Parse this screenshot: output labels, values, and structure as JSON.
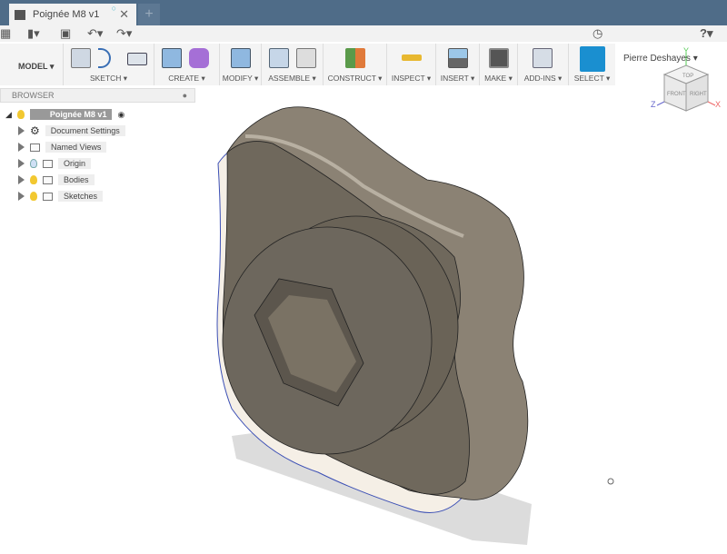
{
  "window": {
    "tab_title": "Poignée M8 v1",
    "new_tab": "+",
    "close": "✕"
  },
  "quickbar": {
    "user": "Pierre Deshayes ▾",
    "help": "?▾",
    "clock_icon": "clock-icon"
  },
  "ribbon": {
    "workspace": "MODEL ▾",
    "groups": [
      "SKETCH ▾",
      "CREATE ▾",
      "MODIFY ▾",
      "ASSEMBLE ▾",
      "CONSTRUCT ▾",
      "INSPECT ▾",
      "INSERT ▾",
      "MAKE ▾",
      "ADD-INS ▾",
      "SELECT ▾"
    ]
  },
  "browser": {
    "title": "BROWSER",
    "root": "Poignée M8 v1",
    "items": [
      "Document Settings",
      "Named Views",
      "Origin",
      "Bodies",
      "Sketches"
    ]
  },
  "viewcube": {
    "top": "TOP",
    "front": "FRONT",
    "right": "RIGHT",
    "x": "X",
    "y": "Y",
    "z": "Z"
  },
  "colors": {
    "titlebar": "#4f6c88",
    "select": "#1a8fd0",
    "body": "#7a7062"
  }
}
